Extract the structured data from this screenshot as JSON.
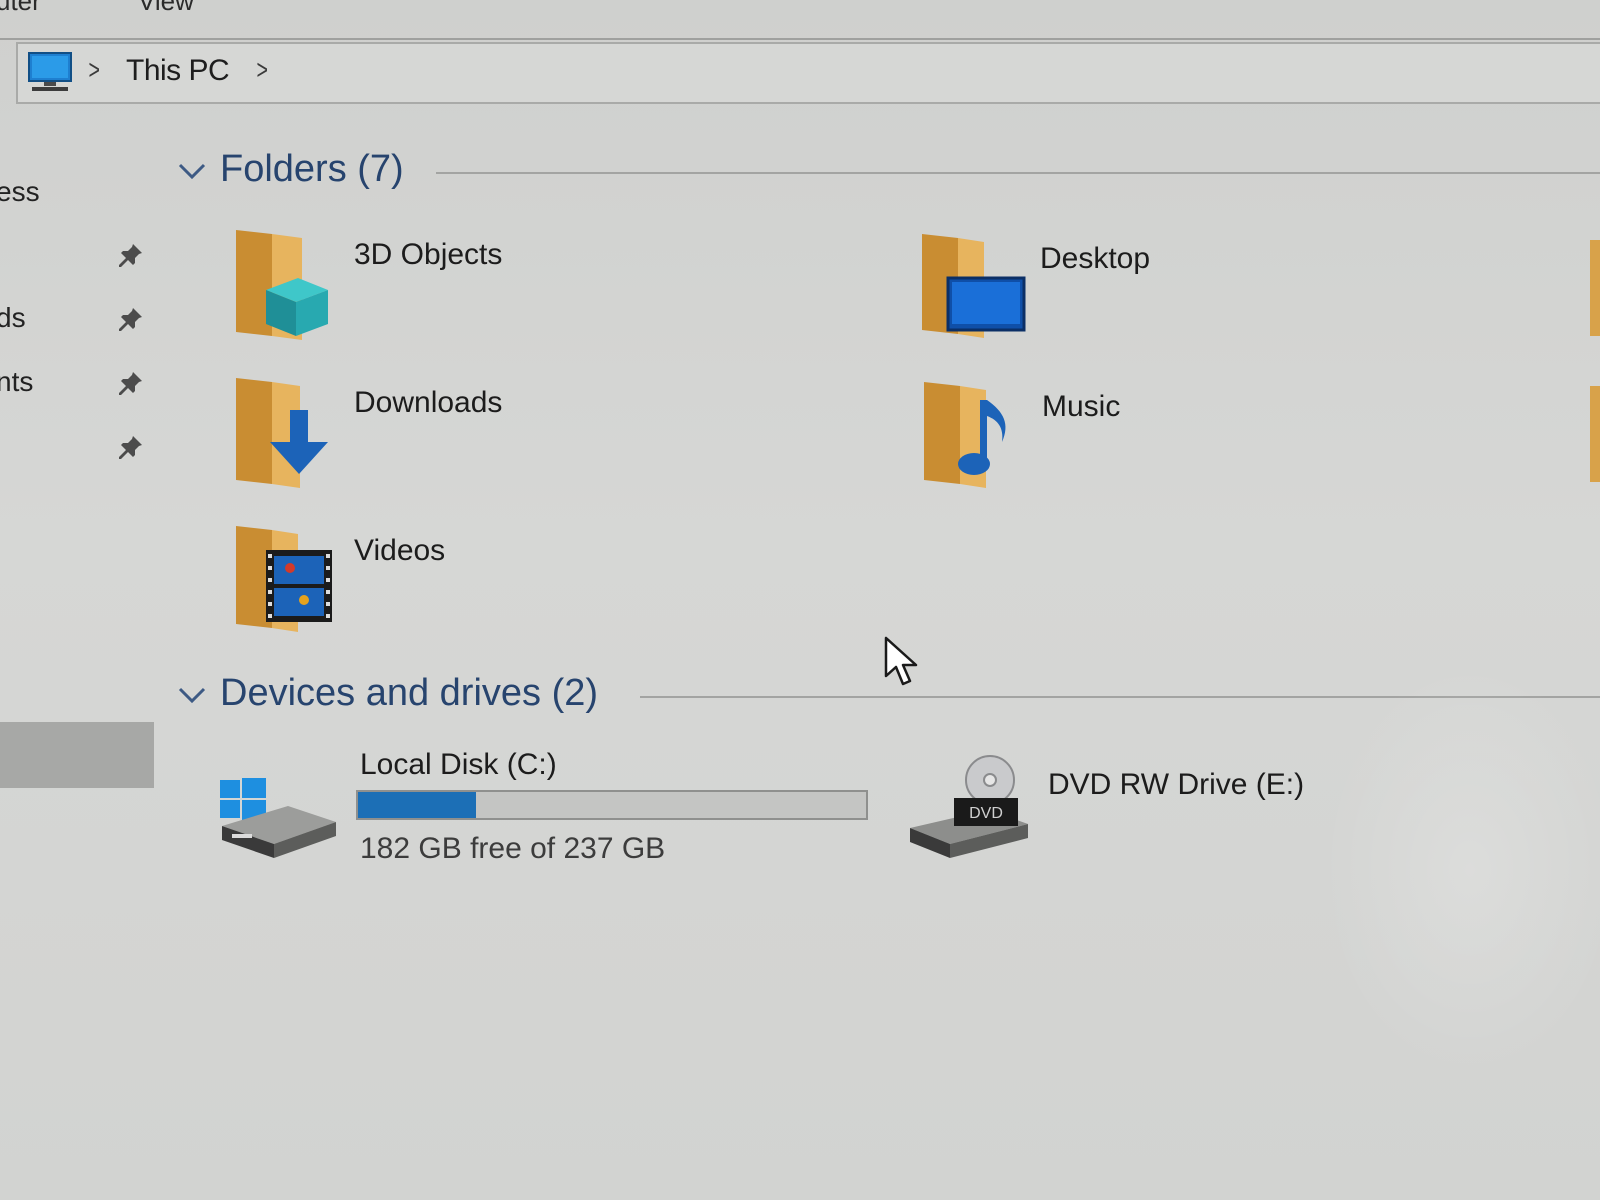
{
  "ribbon": {
    "tabs": [
      "uter",
      "View"
    ]
  },
  "address_bar": {
    "location_icon": "this-pc-monitor-icon",
    "path": [
      "This PC"
    ],
    "separator": ">"
  },
  "nav_pane": {
    "items": [
      {
        "label": "ess",
        "pinned": false
      },
      {
        "label": "",
        "pinned": true
      },
      {
        "label": "ds",
        "pinned": true
      },
      {
        "label": "nts",
        "pinned": true
      },
      {
        "label": "",
        "pinned": true
      }
    ],
    "pin_icon": "pin-icon"
  },
  "groups": {
    "folders": {
      "title": "Folders (7)",
      "items": [
        {
          "label": "3D Objects",
          "icon": "3d-objects-folder-icon"
        },
        {
          "label": "Desktop",
          "icon": "desktop-folder-icon"
        },
        {
          "label": "Downloads",
          "icon": "downloads-folder-icon"
        },
        {
          "label": "Music",
          "icon": "music-folder-icon"
        },
        {
          "label": "Videos",
          "icon": "videos-folder-icon"
        }
      ]
    },
    "devices": {
      "title": "Devices and drives (2)",
      "items": [
        {
          "label": "Local Disk (C:)",
          "icon": "windows-drive-icon",
          "free_text": "182 GB free of 237 GB",
          "used_fraction": 0.232
        },
        {
          "label": "DVD RW Drive (E:)",
          "icon": "dvd-drive-icon"
        }
      ]
    }
  },
  "colors": {
    "accent_blue": "#1c6fb6",
    "group_title": "#27446e",
    "folder_tan": "#d8a24a"
  }
}
